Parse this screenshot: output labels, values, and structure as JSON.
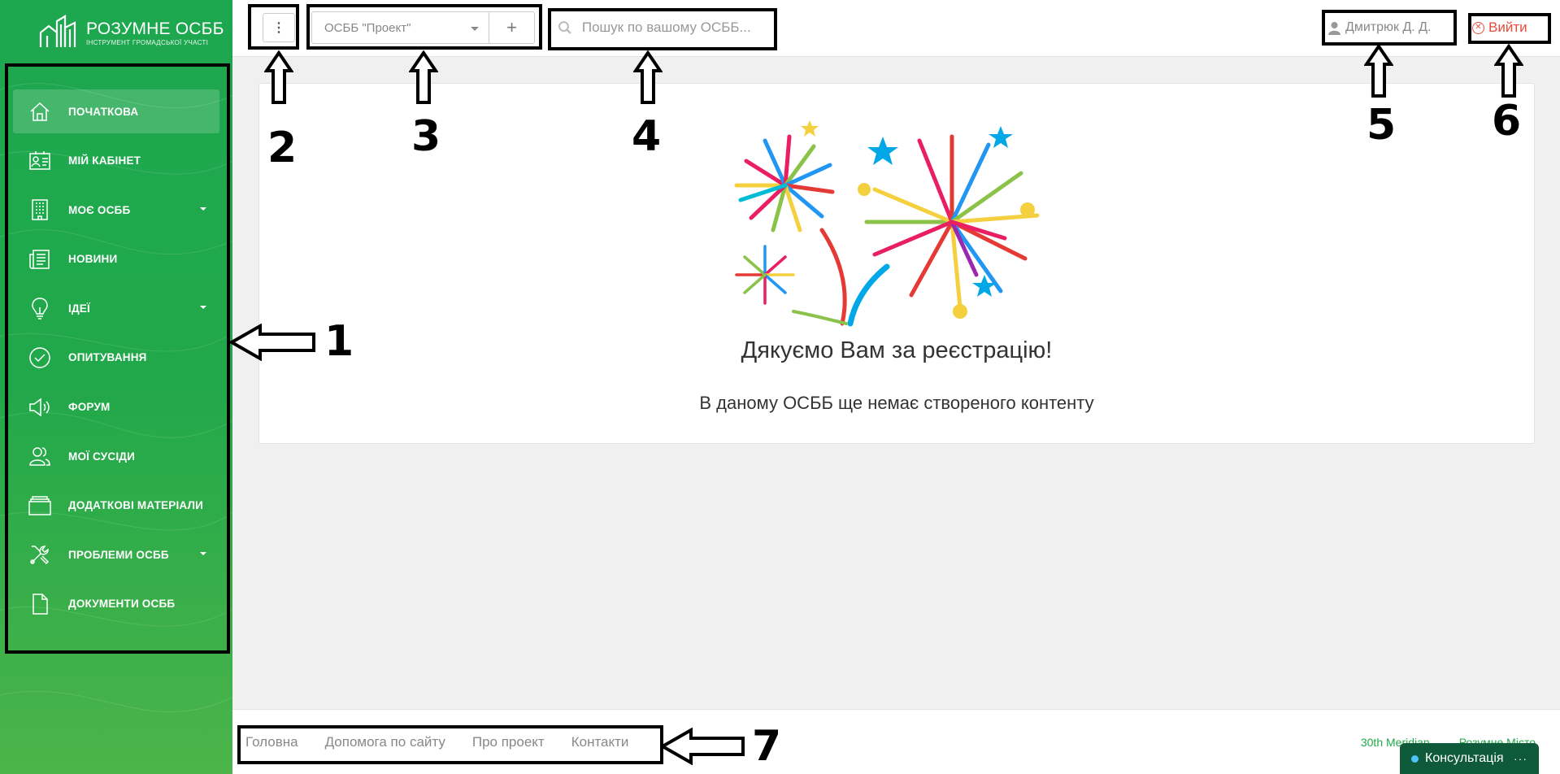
{
  "logo": {
    "name": "РОЗУМНЕ ОСББ",
    "subtitle": "ІНСТРУМЕНТ ГРОМАДСЬКОЇ УЧАСТІ"
  },
  "sidebar": {
    "items": [
      {
        "label": "ПОЧАТКОВА",
        "icon": "home-icon",
        "active": true,
        "has_submenu": false
      },
      {
        "label": "МІЙ КАБІНЕТ",
        "icon": "id-card-icon",
        "active": false,
        "has_submenu": false
      },
      {
        "label": "МОЄ ОСББ",
        "icon": "building-icon",
        "active": false,
        "has_submenu": true
      },
      {
        "label": "НОВИНИ",
        "icon": "newspaper-icon",
        "active": false,
        "has_submenu": false
      },
      {
        "label": "ІДЕЇ",
        "icon": "lightbulb-icon",
        "active": false,
        "has_submenu": true
      },
      {
        "label": "ОПИТУВАННЯ",
        "icon": "check-circle-icon",
        "active": false,
        "has_submenu": false
      },
      {
        "label": "ФОРУМ",
        "icon": "megaphone-icon",
        "active": false,
        "has_submenu": false
      },
      {
        "label": "МОЇ СУСІДИ",
        "icon": "users-icon",
        "active": false,
        "has_submenu": false
      },
      {
        "label": "ДОДАТКОВІ МАТЕРІАЛИ",
        "icon": "folder-icon",
        "active": false,
        "has_submenu": false
      },
      {
        "label": "ПРОБЛЕМИ ОСББ",
        "icon": "tools-icon",
        "active": false,
        "has_submenu": true
      },
      {
        "label": "ДОКУМЕНТИ ОСББ",
        "icon": "document-icon",
        "active": false,
        "has_submenu": false
      }
    ]
  },
  "topbar": {
    "menu_glyph": "⋮",
    "osbb_selected": "ОСББ \"Проект\"",
    "add_glyph": "+",
    "search_placeholder": "Пошук по вашому ОСББ...",
    "user_name": "Дмитрюк Д. Д.",
    "logout_label": "Вийти"
  },
  "main": {
    "thanks": "Дякуємо Вам за реєстрацію!",
    "empty": "В даному ОСББ ще немає створеного контенту"
  },
  "footer": {
    "links": [
      "Головна",
      "Допомога по сайту",
      "Про проект",
      "Контакти"
    ],
    "partners": [
      "30th Meridian",
      "Розумне Місто"
    ]
  },
  "consult": {
    "label": "Консультація",
    "more": "···"
  },
  "annotations": {
    "n1": "1",
    "n2": "2",
    "n3": "3",
    "n4": "4",
    "n5": "5",
    "n6": "6",
    "n7": "7"
  },
  "colors": {
    "sidebar_green": "#1da74f",
    "accent_red": "#e74c3c",
    "consult_bg": "#0f5a3a"
  }
}
